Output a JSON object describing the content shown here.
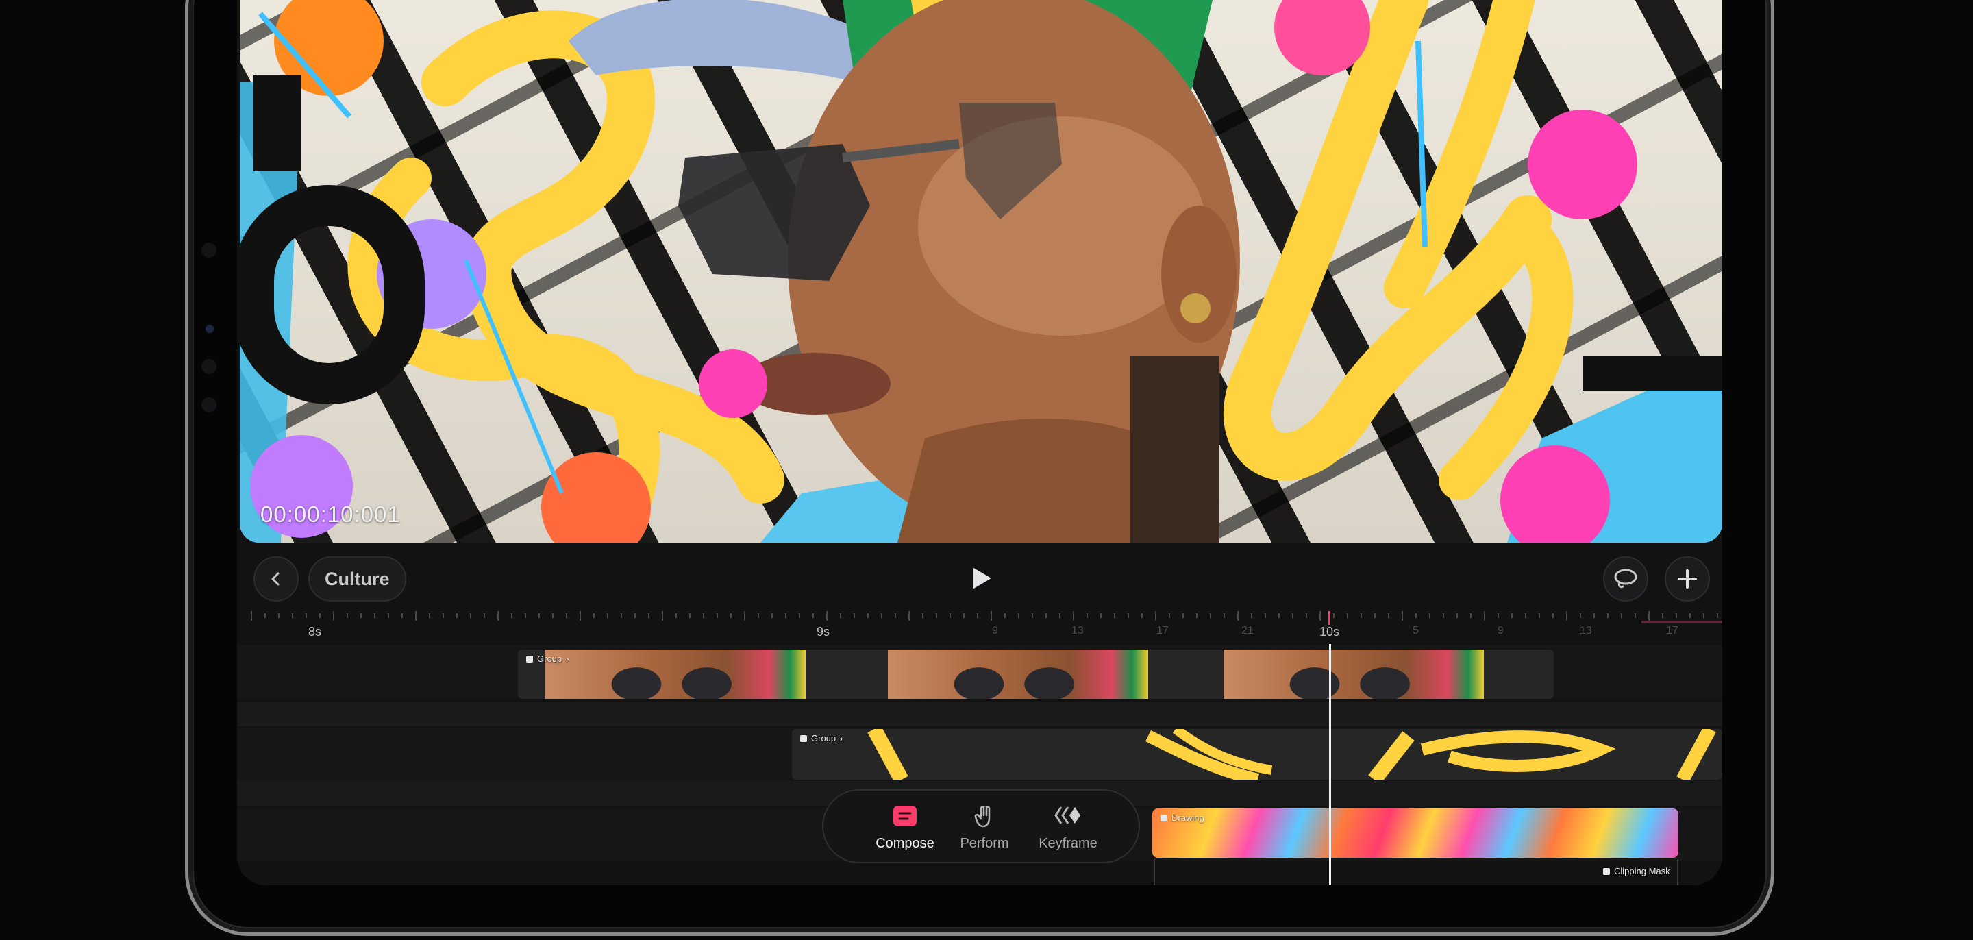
{
  "canvas": {
    "timecode": "00:00:10:001"
  },
  "toolbar": {
    "project_name": "Culture",
    "back_label": "Back",
    "play_label": "Play"
  },
  "ruler": {
    "major_labels": [
      "8s",
      "9s",
      "10s"
    ],
    "minor_labels": [
      "9",
      "13",
      "17",
      "21",
      "5",
      "9",
      "13",
      "17"
    ]
  },
  "tracks": {
    "group1_label": "Group",
    "group2_label": "Group",
    "drawing_label": "Drawing",
    "clipping_mask_label": "Clipping Mask"
  },
  "modes": [
    {
      "label": "Compose",
      "icon": "compose-icon",
      "active": true
    },
    {
      "label": "Perform",
      "icon": "hand-icon",
      "active": false
    },
    {
      "label": "Keyframe",
      "icon": "keyframe-icon",
      "active": false
    }
  ],
  "colors": {
    "accent": "#ff3b6b",
    "artwork_yellow": "#ffd23f",
    "artwork_blue": "#4ec3f0"
  }
}
